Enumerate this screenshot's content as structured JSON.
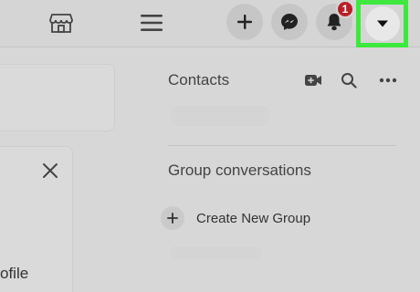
{
  "topbar": {
    "marketplace_icon": "store-icon",
    "menu_icon": "hamburger-menu-icon",
    "create_icon": "plus-icon",
    "messenger_icon": "messenger-icon",
    "notifications_icon": "bell-icon",
    "notifications_count": "1",
    "account_icon": "caret-down-icon",
    "highlight_color": "#3ee83e",
    "badge_color": "#b82029"
  },
  "left_panel": {
    "close_icon": "close-icon",
    "label_fragment": "ofile"
  },
  "contacts": {
    "title": "Contacts",
    "video_icon": "video-plus-icon",
    "search_icon": "search-icon",
    "more_icon": "more-horizontal-icon"
  },
  "groups": {
    "title": "Group conversations",
    "create_label": "Create New Group",
    "create_icon": "plus-icon"
  }
}
